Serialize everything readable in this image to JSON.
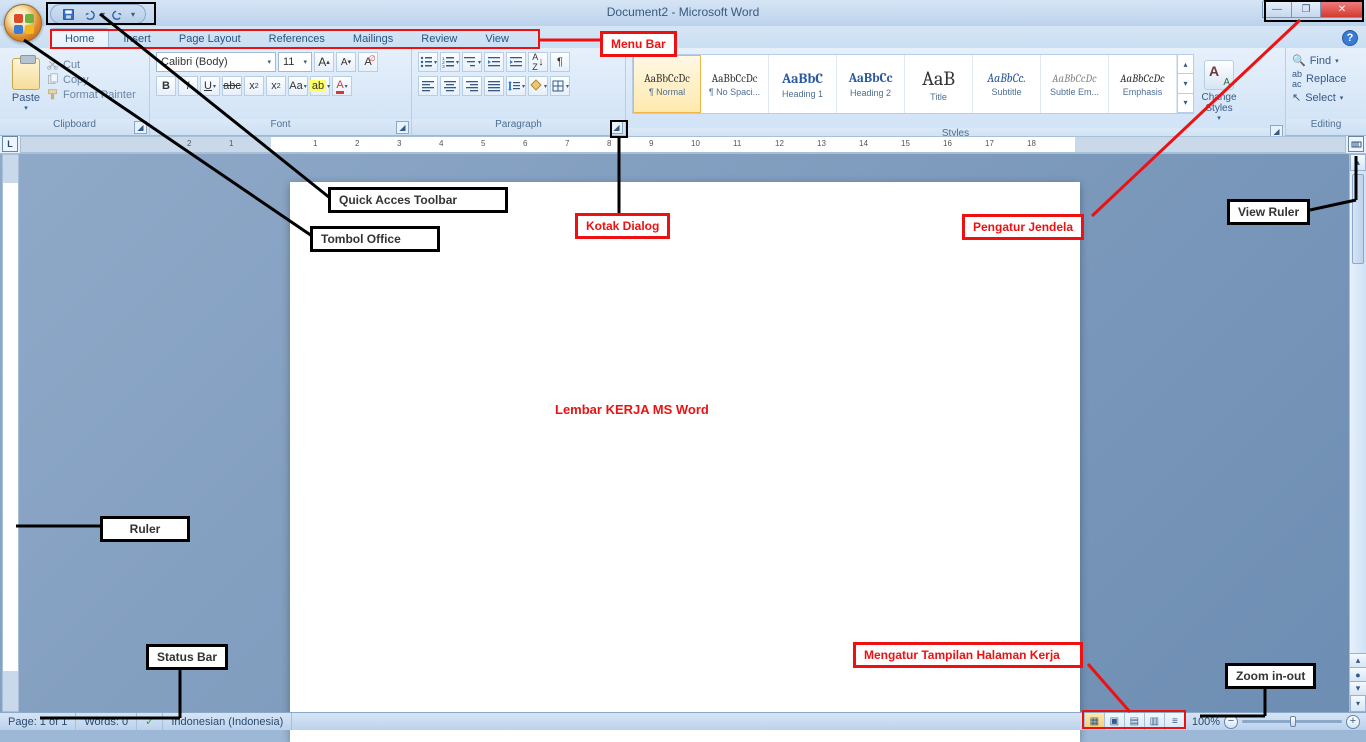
{
  "title": "Document2 - Microsoft Word",
  "qat": {
    "save": "save-icon",
    "undo": "undo-icon",
    "redo": "redo-icon"
  },
  "tabs": [
    "Home",
    "Insert",
    "Page Layout",
    "References",
    "Mailings",
    "Review",
    "View"
  ],
  "active_tab": "Home",
  "groups": {
    "clipboard": {
      "label": "Clipboard",
      "paste": "Paste",
      "cut": "Cut",
      "copy": "Copy",
      "format_painter": "Format Painter"
    },
    "font": {
      "label": "Font",
      "name": "Calibri (Body)",
      "size": "11"
    },
    "paragraph": {
      "label": "Paragraph"
    },
    "styles": {
      "label": "Styles",
      "items": [
        {
          "preview": "AaBbCcDc",
          "name": "¶ Normal",
          "css": "font-size:11px;"
        },
        {
          "preview": "AaBbCcDc",
          "name": "¶ No Spaci...",
          "css": "font-size:11px;"
        },
        {
          "preview": "AaBbC",
          "name": "Heading 1",
          "css": "font-size:14px;color:#2a5aa0;font-weight:bold;"
        },
        {
          "preview": "AaBbCc",
          "name": "Heading 2",
          "css": "font-size:13px;color:#2a5aa0;font-weight:bold;"
        },
        {
          "preview": "AaB",
          "name": "Title",
          "css": "font-size:20px;"
        },
        {
          "preview": "AaBbCc.",
          "name": "Subtitle",
          "css": "font-size:12px;font-style:italic;color:#2a5aa0;"
        },
        {
          "preview": "AaBbCcDc",
          "name": "Subtle Em...",
          "css": "font-size:11px;font-style:italic;color:#888;"
        },
        {
          "preview": "AaBbCcDc",
          "name": "Emphasis",
          "css": "font-size:11px;font-style:italic;"
        }
      ],
      "change": "Change Styles"
    },
    "editing": {
      "label": "Editing",
      "find": "Find",
      "replace": "Replace",
      "select": "Select"
    }
  },
  "status": {
    "page": "Page: 1 of 1",
    "words": "Words: 0",
    "lang": "Indonesian (Indonesia)",
    "zoom": "100%"
  },
  "annotations": {
    "menu_bar": "Menu Bar",
    "quick_access": "Quick Acces Toolbar",
    "tombol_office": "Tombol Office",
    "kotak_dialog": "Kotak Dialog",
    "pengatur_jendela": "Pengatur Jendela",
    "view_ruler": "View Ruler",
    "lembar_kerja": "Lembar KERJA MS Word",
    "ruler": "Ruler",
    "status_bar": "Status Bar",
    "mengatur_tampilan": "Mengatur Tampilan Halaman Kerja",
    "zoom": "Zoom in-out"
  }
}
